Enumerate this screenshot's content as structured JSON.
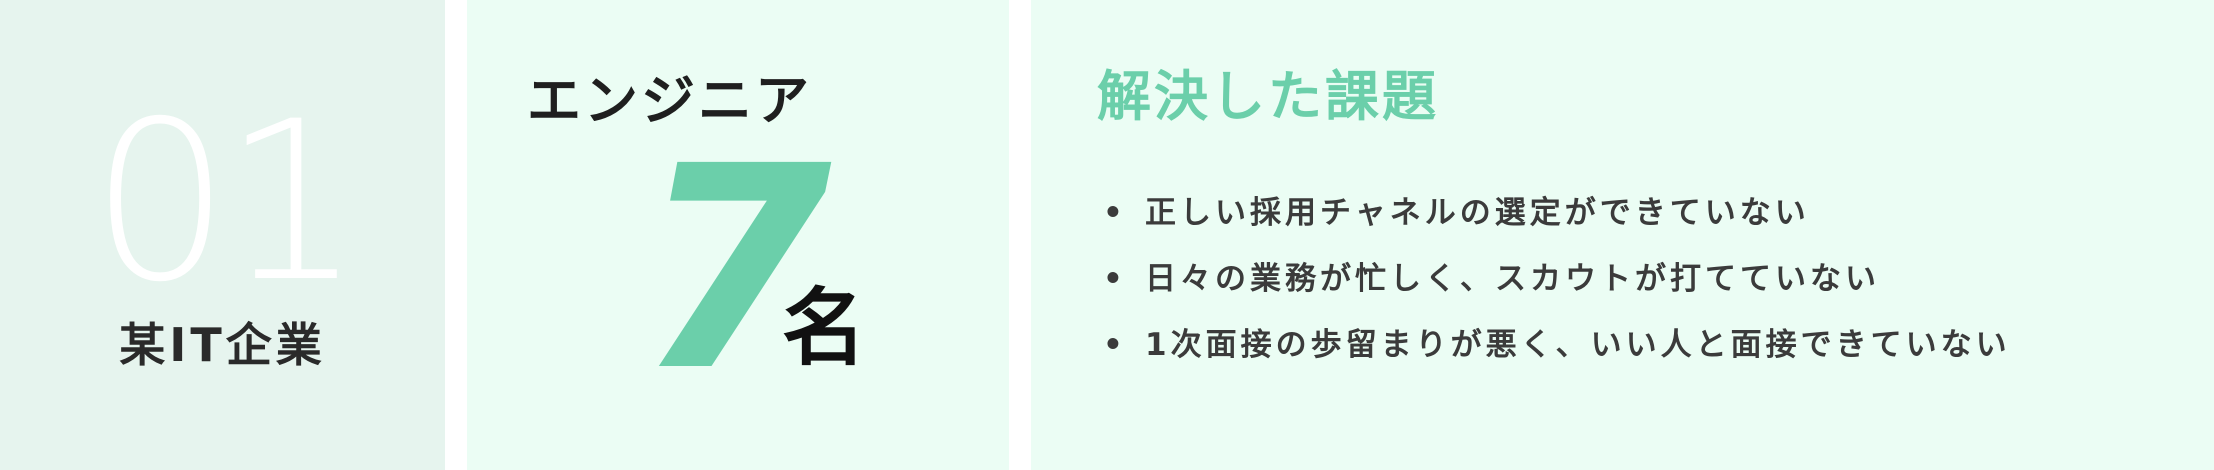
{
  "company_card": {
    "number": "01",
    "company_name": "某IT企業"
  },
  "role_card": {
    "role": "エンジニア",
    "count": "7",
    "unit": "名"
  },
  "issues_card": {
    "title": "解決した課題",
    "bullet": "•",
    "items": [
      "正しい採用チャネルの選定ができていない",
      "日々の業務が忙しく、スカウトが打てていない",
      "1次面接の歩留まりが悪く、いい人と面接できていない"
    ]
  },
  "colors": {
    "accent": "#6bcfaa",
    "card_company_bg": "#e6f4ee",
    "card_bg": "#ebfdf4",
    "text_dark": "#2a2a2a"
  }
}
